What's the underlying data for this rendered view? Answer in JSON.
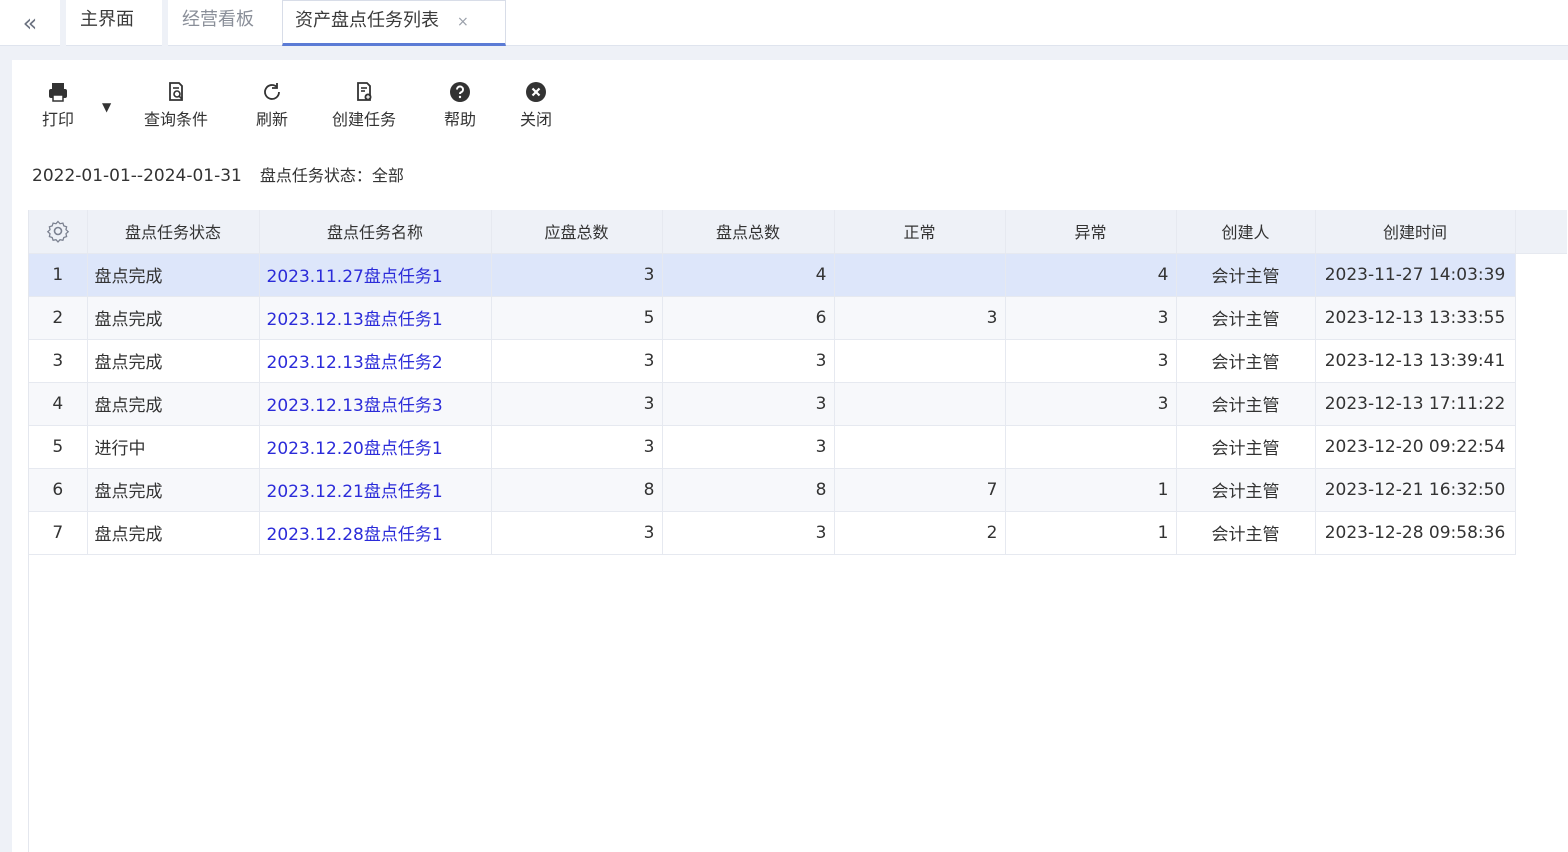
{
  "tabs": {
    "collapse_icon": "double-chevron-left-icon",
    "collapse_glyph": "«",
    "items": [
      {
        "label": "主界面"
      },
      {
        "label": "经营看板"
      },
      {
        "label": "资产盘点任务列表",
        "close_glyph": "×"
      }
    ]
  },
  "toolbar": {
    "print": {
      "label": "打印",
      "icon": "printer-icon"
    },
    "print_dropdown_glyph": "▼",
    "query": {
      "label": "查询条件",
      "icon": "query-document-icon"
    },
    "refresh": {
      "label": "刷新",
      "icon": "refresh-icon"
    },
    "create": {
      "label": "创建任务",
      "icon": "create-document-icon"
    },
    "help": {
      "label": "帮助",
      "icon": "help-icon"
    },
    "close": {
      "label": "关闭",
      "icon": "close-circle-icon"
    }
  },
  "filter": {
    "date_range": "2022-01-01--2024-01-31",
    "status_text": "盘点任务状态：全部"
  },
  "table": {
    "settings_icon": "gear-icon",
    "columns": [
      "盘点任务状态",
      "盘点任务名称",
      "应盘总数",
      "盘点总数",
      "正常",
      "异常",
      "创建人",
      "创建时间"
    ],
    "rows": [
      {
        "idx": "1",
        "status": "盘点完成",
        "name": "2023.11.27盘点任务1",
        "expected": "3",
        "counted": "4",
        "normal": "",
        "abnormal": "4",
        "creator": "会计主管",
        "created": "2023-11-27 14:03:39"
      },
      {
        "idx": "2",
        "status": "盘点完成",
        "name": "2023.12.13盘点任务1",
        "expected": "5",
        "counted": "6",
        "normal": "3",
        "abnormal": "3",
        "creator": "会计主管",
        "created": "2023-12-13 13:33:55"
      },
      {
        "idx": "3",
        "status": "盘点完成",
        "name": "2023.12.13盘点任务2",
        "expected": "3",
        "counted": "3",
        "normal": "",
        "abnormal": "3",
        "creator": "会计主管",
        "created": "2023-12-13 13:39:41"
      },
      {
        "idx": "4",
        "status": "盘点完成",
        "name": "2023.12.13盘点任务3",
        "expected": "3",
        "counted": "3",
        "normal": "",
        "abnormal": "3",
        "creator": "会计主管",
        "created": "2023-12-13 17:11:22"
      },
      {
        "idx": "5",
        "status": "进行中",
        "name": "2023.12.20盘点任务1",
        "expected": "3",
        "counted": "3",
        "normal": "",
        "abnormal": "",
        "creator": "会计主管",
        "created": "2023-12-20 09:22:54"
      },
      {
        "idx": "6",
        "status": "盘点完成",
        "name": "2023.12.21盘点任务1",
        "expected": "8",
        "counted": "8",
        "normal": "7",
        "abnormal": "1",
        "creator": "会计主管",
        "created": "2023-12-21 16:32:50"
      },
      {
        "idx": "7",
        "status": "盘点完成",
        "name": "2023.12.28盘点任务1",
        "expected": "3",
        "counted": "3",
        "normal": "2",
        "abnormal": "1",
        "creator": "会计主管",
        "created": "2023-12-28 09:58:36"
      }
    ]
  },
  "colors": {
    "accent": "#5b7bd5",
    "link": "#2b2bd9",
    "selected_row": "#dde6fa",
    "header_bg": "#eef1f7"
  }
}
